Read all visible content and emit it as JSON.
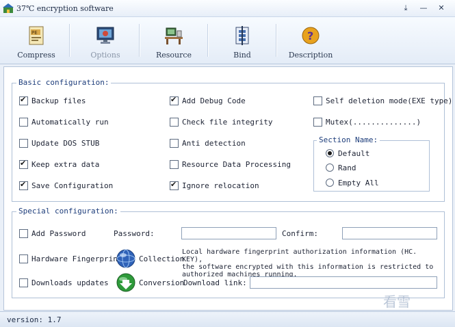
{
  "window": {
    "title": "37℃ encryption software",
    "controls": {
      "pin": "⤓",
      "minimize": "—",
      "close": "✕"
    }
  },
  "toolbar": {
    "compress": "Compress",
    "options": "Options",
    "resource": "Resource",
    "bind": "Bind",
    "description": "Description"
  },
  "basic": {
    "title": "Basic configuration:",
    "backup_files": "Backup files",
    "automatically_run": "Automatically run",
    "update_dos_stub": "Update DOS STUB",
    "keep_extra_data": "Keep extra data",
    "save_configuration": "Save Configuration",
    "add_debug_code": "Add Debug Code",
    "check_file_integrity": "Check file integrity",
    "anti_detection": "Anti detection",
    "resource_data_processing": "Resource Data Processing",
    "ignore_relocation": "Ignore relocation",
    "self_deletion_mode": "Self deletion mode(EXE type)",
    "mutex": "Mutex(..............)",
    "section_name": {
      "title": "Section Name:",
      "default": "Default",
      "rand": "Rand",
      "empty_all": "Empty All"
    }
  },
  "special": {
    "title": "Special configuration:",
    "add_password": "Add Password",
    "password_label": "Password:",
    "password_value": "",
    "confirm_label": "Confirm:",
    "confirm_value": "",
    "hardware_fingerprint": "Hardware Fingerprint",
    "collection": "Collection",
    "hw_info_1": "Local hardware fingerprint authorization information (HC. KEY),",
    "hw_info_2": "the software encrypted with this information is restricted to",
    "hw_info_3": "authorized machines running.",
    "downloads_updates": "Downloads updates",
    "conversion": "Conversion",
    "download_link_label": "Download link:",
    "download_link_value": ""
  },
  "status": {
    "version": "version: 1.7"
  },
  "watermark": "看雪"
}
